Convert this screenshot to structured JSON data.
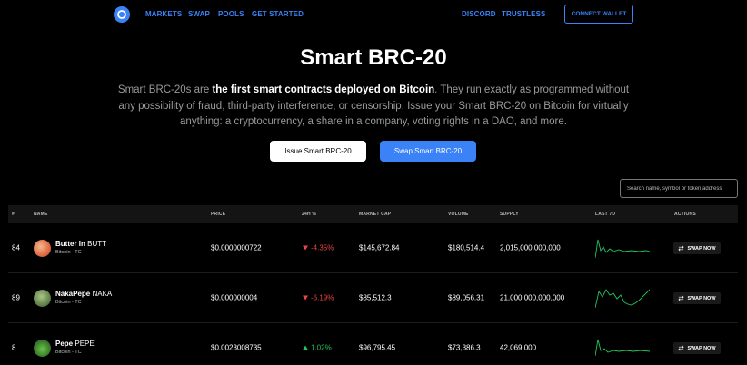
{
  "nav": {
    "logo": "logo-icon",
    "links_left": [
      "MARKETS",
      "SWAP",
      "POOLS",
      "GET STARTED"
    ],
    "links_right": [
      "DISCORD",
      "TRUSTLESS"
    ],
    "connect_label": "CONNECT WALLET",
    "accent": "#3b82f6"
  },
  "hero": {
    "title": "Smart BRC-20",
    "desc_pre": "Smart BRC-20s are ",
    "desc_bold": "the first smart contracts deployed on Bitcoin",
    "desc_post": ". They run exactly as programmed without any possibility of fraud, third-party interference, or censorship. Issue your Smart BRC-20 on Bitcoin for virtually anything: a cryptocurrency, a share in a company, voting rights in a DAO, and more.",
    "issue_label": "Issue Smart BRC-20",
    "swap_label": "Swap Smart BRC-20"
  },
  "search": {
    "placeholder": "Search name, symbol or token address"
  },
  "table": {
    "headers": [
      "#",
      "NAME",
      "PRICE",
      "24H %",
      "MARKET CAP",
      "VOLUME",
      "SUPPLY",
      "LAST 7D",
      "ACTIONS"
    ],
    "action_label": "SWAP NOW",
    "rows": [
      {
        "rank": "84",
        "name": "Butter In",
        "symbol": "BUTT",
        "network": "Bitcoin - TC",
        "price": "$0.0000000722",
        "change": "-4.35%",
        "direction": "down",
        "market_cap": "$145,672.84",
        "volume": "$180,514.4",
        "supply": "2,015,000,000,000",
        "icon": "butter-token-icon",
        "icon_color": "#e8774f"
      },
      {
        "rank": "89",
        "name": "NakaPepe",
        "symbol": "NAKA",
        "network": "Bitcoin - TC",
        "price": "$0.000000004",
        "change": "-6.19%",
        "direction": "down",
        "market_cap": "$85,512.3",
        "volume": "$89,056.31",
        "supply": "21,000,000,000,000",
        "icon": "nakapepe-token-icon",
        "icon_color": "#6b8f4e"
      },
      {
        "rank": "8",
        "name": "Pepe",
        "symbol": "PEPE",
        "network": "Bitcoin - TC",
        "price": "$0.0023008735",
        "change": "1.02%",
        "direction": "up",
        "market_cap": "$96,795.45",
        "volume": "$73,386.3",
        "supply": "42,069,000",
        "icon": "pepe-token-icon",
        "icon_color": "#4a9a3a"
      }
    ]
  },
  "colors": {
    "down": "#ef4444",
    "up": "#22c55e",
    "sparkline": "#22c55e"
  }
}
